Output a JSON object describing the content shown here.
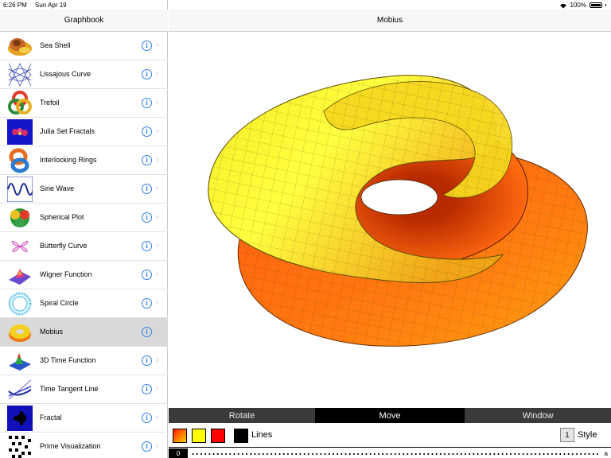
{
  "status_bar": {
    "time": "6:26 PM",
    "date": "Sun Apr 19",
    "battery": "100%"
  },
  "sidebar": {
    "title": "Graphbook",
    "info_glyph": "i",
    "chevron_glyph": "›",
    "items": [
      {
        "label": "Sea Shell",
        "icon": "sea-shell-thumbnail",
        "selected": false
      },
      {
        "label": "Lissajous Curve",
        "icon": "lissajous-curve-thumbnail",
        "selected": false
      },
      {
        "label": "Trefoil",
        "icon": "trefoil-thumbnail",
        "selected": false
      },
      {
        "label": "Julia Set Fractals",
        "icon": "julia-set-thumbnail",
        "selected": false
      },
      {
        "label": "Interlocking Rings",
        "icon": "interlocking-rings-thumbnail",
        "selected": false
      },
      {
        "label": "Sine Wave",
        "icon": "sine-wave-thumbnail",
        "selected": false
      },
      {
        "label": "Spherical Plot",
        "icon": "spherical-plot-thumbnail",
        "selected": false
      },
      {
        "label": "Butterfly Curve",
        "icon": "butterfly-curve-thumbnail",
        "selected": false
      },
      {
        "label": "Wigner Function",
        "icon": "wigner-function-thumbnail",
        "selected": false
      },
      {
        "label": "Spiral Circle",
        "icon": "spiral-circle-thumbnail",
        "selected": false
      },
      {
        "label": "Mobius",
        "icon": "mobius-thumbnail",
        "selected": true
      },
      {
        "label": "3D Time Function",
        "icon": "3d-time-function-thumbnail",
        "selected": false
      },
      {
        "label": "Time Tangent Line",
        "icon": "time-tangent-line-thumbnail",
        "selected": false
      },
      {
        "label": "Fractal",
        "icon": "fractal-thumbnail",
        "selected": false
      },
      {
        "label": "Prime Visualization",
        "icon": "prime-visualization-thumbnail",
        "selected": false
      }
    ]
  },
  "main": {
    "title": "Mobius",
    "surface_colors": {
      "light": "#ffff33",
      "mid": "#f2c200",
      "dark": "#ff6a10"
    },
    "modes": [
      {
        "label": "Rotate",
        "active": false
      },
      {
        "label": "Move",
        "active": true
      },
      {
        "label": "Window",
        "active": false
      }
    ],
    "controls": {
      "swatches": [
        {
          "name": "gradient-swatch",
          "color": "#ff7a00"
        },
        {
          "name": "yellow-swatch",
          "color": "#ffff00"
        },
        {
          "name": "red-swatch",
          "color": "#ff0000"
        },
        {
          "name": "black-swatch",
          "color": "#000000"
        }
      ],
      "lines_label": "Lines",
      "style_value": "1",
      "style_label": "Style"
    },
    "slider": {
      "start_label": "0",
      "end_label": "a"
    }
  }
}
